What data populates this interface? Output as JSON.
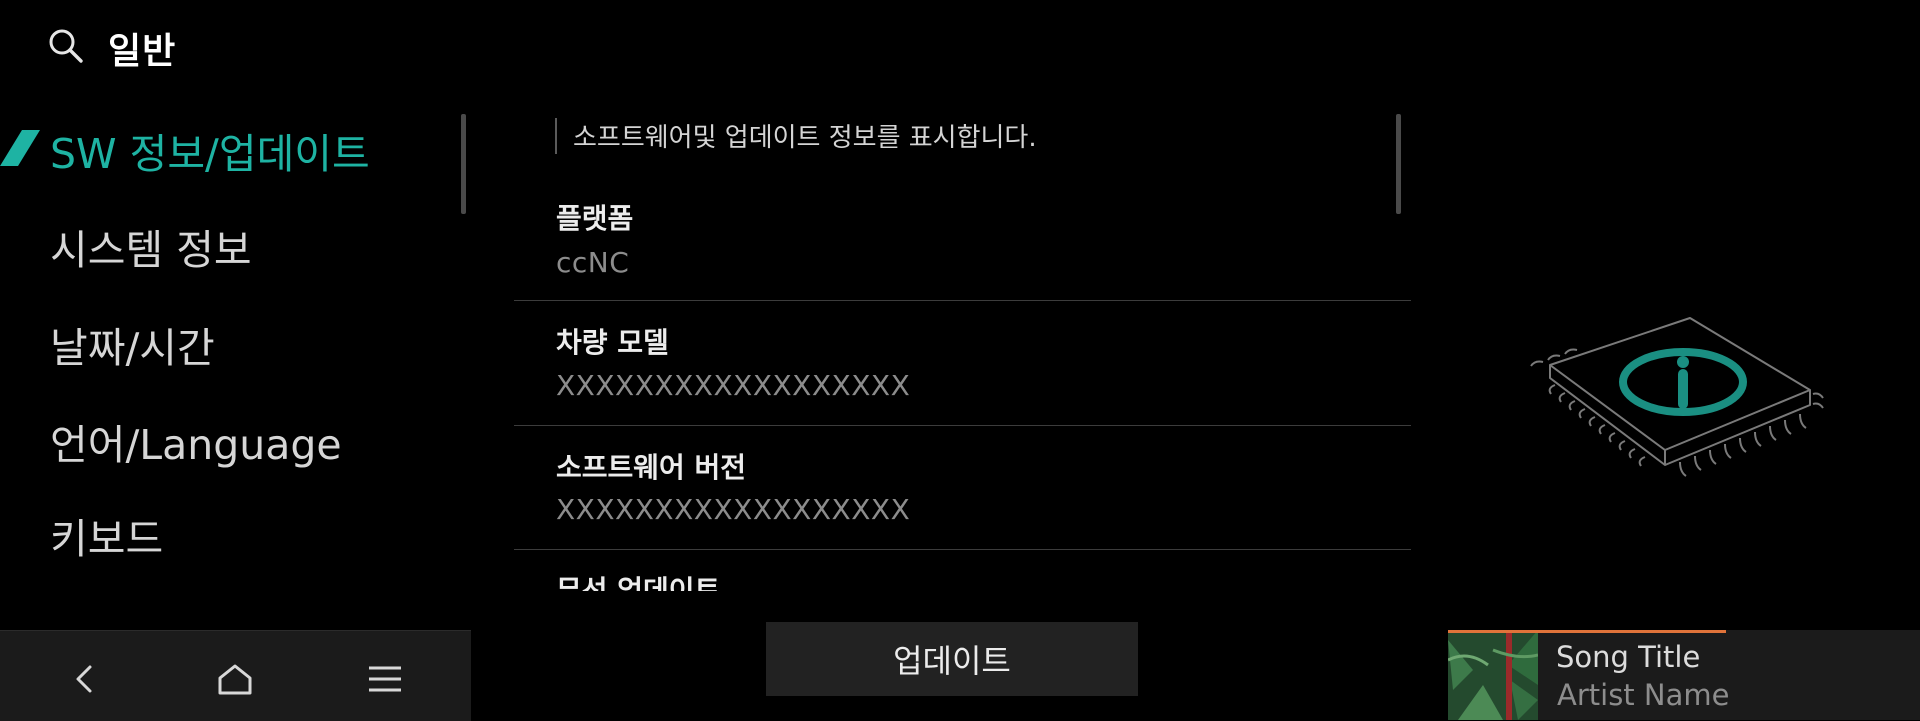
{
  "header": {
    "title": "일반",
    "search_icon": "search-icon"
  },
  "sidebar": {
    "items": [
      {
        "label": "SW 정보/업데이트",
        "active": true
      },
      {
        "label": "시스템 정보",
        "active": false
      },
      {
        "label": "날짜/시간",
        "active": false
      },
      {
        "label": "언어/Language",
        "active": false
      },
      {
        "label": "키보드",
        "active": false
      }
    ]
  },
  "content": {
    "description": "소프트웨어및 업데이트 정보를 표시합니다.",
    "rows": [
      {
        "title": "플랫폼",
        "value": "ccNC"
      },
      {
        "title": "차량 모델",
        "value": "XXXXXXXXXXXXXXXXXX"
      },
      {
        "title": "소프트웨어 버전",
        "value": "XXXXXXXXXXXXXXXXXX"
      },
      {
        "title": "무선 업데이트",
        "value": ""
      }
    ]
  },
  "update_button": {
    "label": "업데이트"
  },
  "navbar": {
    "icons": [
      "back-icon",
      "home-icon",
      "menu-icon"
    ]
  },
  "media": {
    "song_title": "Song Title",
    "artist_name": "Artist Name",
    "progress": 0.59
  },
  "colors": {
    "accent": "#1eb3a3",
    "media_progress": "#e0733a",
    "background": "#000000"
  },
  "illustration": {
    "icon": "chip-info-icon"
  }
}
